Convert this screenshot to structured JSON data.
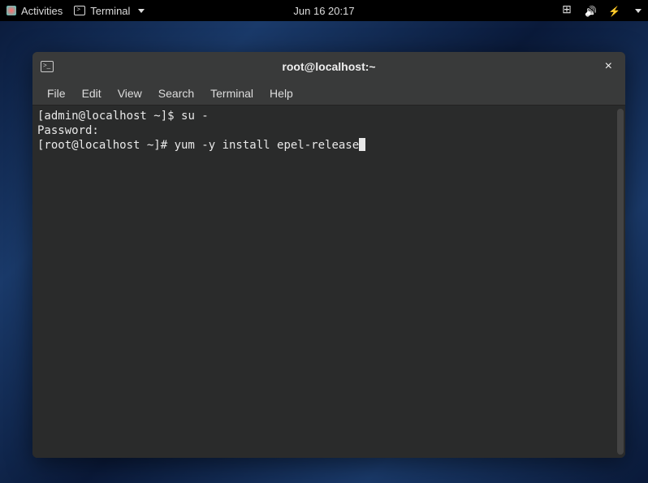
{
  "topbar": {
    "activities": "Activities",
    "app_label": "Terminal",
    "datetime": "Jun 16  20:17"
  },
  "window": {
    "title": "root@localhost:~"
  },
  "menu": {
    "file": "File",
    "edit": "Edit",
    "view": "View",
    "search": "Search",
    "terminal": "Terminal",
    "help": "Help"
  },
  "terminal": {
    "line1_prompt": "[admin@localhost ~]$ ",
    "line1_cmd": "su -",
    "line2": "Password:",
    "line3_prompt": "[root@localhost ~]# ",
    "line3_cmd": "yum -y install epel-release"
  }
}
